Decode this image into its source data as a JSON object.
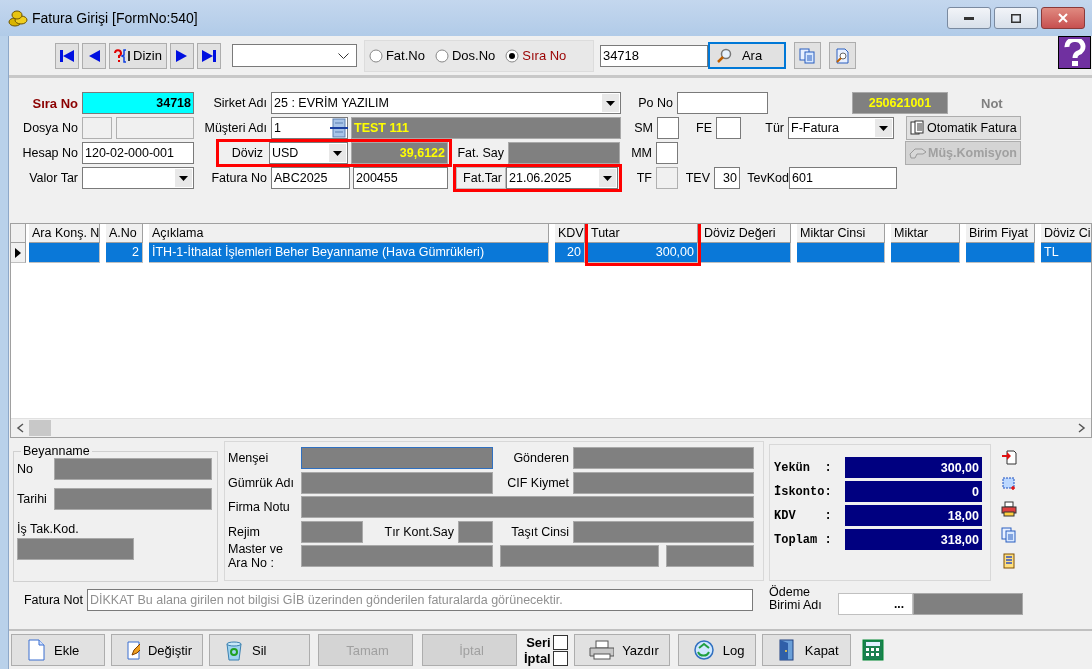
{
  "window": {
    "title": "Fatura Girişi [FormNo:540]"
  },
  "toolbar": {
    "nav": [
      {
        "kind": "first"
      },
      {
        "kind": "prev"
      },
      {
        "kind": "index",
        "label": "Dizin"
      },
      {
        "kind": "next"
      },
      {
        "kind": "last"
      }
    ],
    "search_modes": [
      {
        "label": "Fat.No",
        "selected": false
      },
      {
        "label": "Dos.No",
        "selected": false
      },
      {
        "label": "Sıra No",
        "selected": true
      }
    ],
    "search": {
      "value": "34718",
      "button": "Ara"
    }
  },
  "form": {
    "sira_no": {
      "label": "Sıra No",
      "value": "34718"
    },
    "sirket_adi": {
      "label": "Sirket Adı",
      "value": "25 : EVRİM YAZILIM"
    },
    "po_no": {
      "label": "Po No"
    },
    "document_code": "250621001",
    "not_label": "Not",
    "dosya_no": {
      "label": "Dosya No"
    },
    "musteri_adi": {
      "label": "Müşteri Adı",
      "code": "1",
      "name": "TEST 111"
    },
    "sm": {
      "label": "SM"
    },
    "fe": {
      "label": "FE"
    },
    "tur": {
      "label": "Tür",
      "value": "F-Fatura"
    },
    "buttons": [
      {
        "label": "Otomatik Fatura",
        "disabled": false
      },
      {
        "label": "Müş.Komisyon",
        "disabled": true
      }
    ],
    "hesap_no": {
      "label": "Hesap No",
      "value": "120-02-000-001"
    },
    "doviz": {
      "label": "Döviz",
      "value": "USD",
      "rate": "39,6122",
      "highlight": true
    },
    "fat_say": {
      "label": "Fat. Say"
    },
    "mm": {
      "label": "MM"
    },
    "valor_tar": {
      "label": "Valor Tar"
    },
    "fatura_no": {
      "label": "Fatura No",
      "series": "ABC2025",
      "number": "200455"
    },
    "fat_tar": {
      "label": "Fat.Tar",
      "value": "21.06.2025",
      "highlight": true
    },
    "tf": {
      "label": "TF",
      "disabled": true
    },
    "tev": {
      "label": "TEV",
      "value": "30"
    },
    "tevkod": {
      "label": "TevKod",
      "value": "601"
    }
  },
  "grid": {
    "columns": [
      {
        "label": "Ara Konş. N",
        "highlight": false
      },
      {
        "label": "A.No",
        "highlight": false
      },
      {
        "label": "Açıklama",
        "highlight": false
      },
      {
        "label": "KDV",
        "highlight": false
      },
      {
        "label": "Tutar",
        "highlight": true
      },
      {
        "label": "Döviz Değeri",
        "highlight": false
      },
      {
        "label": "Miktar Cinsi",
        "highlight": false
      },
      {
        "label": "Miktar",
        "highlight": false
      },
      {
        "label": "Birim Fiyat",
        "highlight": false
      },
      {
        "label": "Döviz Ci",
        "highlight": false
      }
    ],
    "rows": [
      {
        "selected": true,
        "cells": [
          null,
          "2",
          "İTH-1-İthalat İşlemleri Beher Beyanname (Hava Gümrükleri)",
          "20",
          "300,00",
          null,
          null,
          null,
          null,
          "TL"
        ]
      }
    ]
  },
  "beyanname": {
    "title": "Beyanname",
    "no": "No",
    "tarihi": "Tarihi",
    "is_tak_kod": "İş Tak.Kod."
  },
  "details": {
    "mensei": "Menşei",
    "gonderen": "Gönderen",
    "gumruk_adi": "Gümrük Adı",
    "cif_kiymet": "CIF Kiymet",
    "firma_notu": "Firma Notu",
    "rejim": "Rejim",
    "tir_kont_say": "Tır Kont.Say",
    "tasit_cinsi": "Taşıt Cinsi",
    "master": "Master ve\nAra No :"
  },
  "totals": [
    {
      "label": "Yekün  :",
      "value": "300,00"
    },
    {
      "label": "İskonto:",
      "value": "0"
    },
    {
      "label": "KDV    :",
      "value": "18,00"
    },
    {
      "label": "Toplam :",
      "value": "318,00"
    }
  ],
  "fatura_not": {
    "label": "Fatura Not",
    "placeholder": "DİKKAT Bu alana girilen not bilgisi GİB üzerinden gönderilen faturalarda görünecektir."
  },
  "odeme": {
    "label": "Ödeme Birimi Adı",
    "button": "..."
  },
  "actions": [
    {
      "kind": "add",
      "label": "Ekle",
      "disabled": false
    },
    {
      "kind": "edit",
      "label": "Değiştir",
      "disabled": false
    },
    {
      "kind": "delete",
      "label": "Sil",
      "disabled": false
    },
    {
      "kind": "ok",
      "label": "Tamam",
      "disabled": true
    },
    {
      "kind": "cancel",
      "label": "İptal",
      "disabled": true
    },
    {
      "kind": "checks",
      "items": [
        {
          "label": "Seri",
          "checked": false
        },
        {
          "label": "İptal",
          "checked": false
        }
      ]
    },
    {
      "kind": "print",
      "label": "Yazdır",
      "disabled": false
    },
    {
      "kind": "log",
      "label": "Log",
      "disabled": false
    },
    {
      "kind": "exit",
      "label": "Kapat",
      "disabled": false
    }
  ]
}
